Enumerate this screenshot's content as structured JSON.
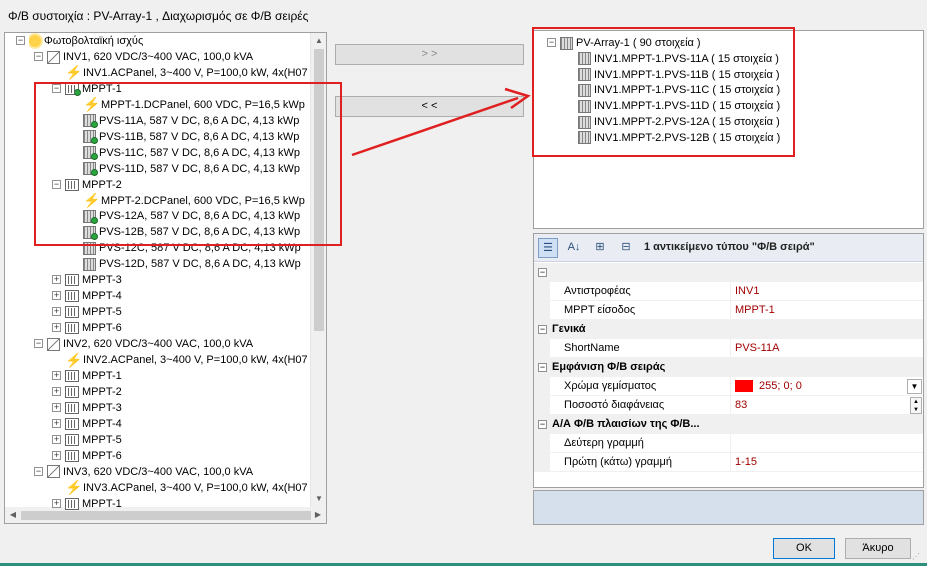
{
  "window": {
    "title": "Φ/Β συστοιχία : PV-Array-1 , Διαχωρισμός σε Φ/Β σειρές"
  },
  "buttons": {
    "add": "> >",
    "remove": "< <",
    "ok": "OK",
    "cancel": "Άκυρο"
  },
  "left_tree": [
    {
      "text": "Φωτοβολταϊκή ισχύς",
      "icon": "sun-icon",
      "exp": "−",
      "level": 0
    },
    {
      "text": "INV1, 620 VDC/3~400 VAC, 100,0 kVA",
      "icon": "inverter-icon",
      "exp": "−",
      "level": 1
    },
    {
      "text": "INV1.ACPanel, 3~400 V, P=100,0 kW, 4x(H07",
      "icon": "bolt-icon",
      "exp": "",
      "level": 2
    },
    {
      "text": "MPPT-1",
      "icon": "mppt-icon",
      "exp": "−",
      "level": 2,
      "dot": true
    },
    {
      "text": "MPPT-1.DCPanel, 600 VDC,  P=16,5 kWp",
      "icon": "bolt-icon",
      "exp": "",
      "level": 3
    },
    {
      "text": "PVS-11A, 587 V DC, 8,6 A DC, 4,13 kWp",
      "icon": "pv-string-icon",
      "exp": "",
      "level": 3,
      "dot": true
    },
    {
      "text": "PVS-11B, 587 V DC, 8,6 A DC, 4,13 kWp",
      "icon": "pv-string-icon",
      "exp": "",
      "level": 3,
      "dot": true
    },
    {
      "text": "PVS-11C, 587 V DC, 8,6 A DC, 4,13 kWp",
      "icon": "pv-string-icon",
      "exp": "",
      "level": 3,
      "dot": true
    },
    {
      "text": "PVS-11D, 587 V DC, 8,6 A DC, 4,13 kWp",
      "icon": "pv-string-icon",
      "exp": "",
      "level": 3,
      "dot": true
    },
    {
      "text": "MPPT-2",
      "icon": "mppt-icon",
      "exp": "−",
      "level": 2
    },
    {
      "text": "MPPT-2.DCPanel, 600 VDC,  P=16,5 kWp",
      "icon": "bolt-icon",
      "exp": "",
      "level": 3
    },
    {
      "text": "PVS-12A, 587 V DC, 8,6 A DC, 4,13 kWp",
      "icon": "pv-string-icon",
      "exp": "",
      "level": 3,
      "dot": true
    },
    {
      "text": "PVS-12B, 587 V DC, 8,6 A DC, 4,13 kWp",
      "icon": "pv-string-icon",
      "exp": "",
      "level": 3,
      "dot": true
    },
    {
      "text": "PVS-12C, 587 V DC, 8,6 A DC, 4,13 kWp",
      "icon": "pv-string-icon",
      "exp": "",
      "level": 3
    },
    {
      "text": "PVS-12D, 587 V DC, 8,6 A DC, 4,13 kWp",
      "icon": "pv-string-icon",
      "exp": "",
      "level": 3
    },
    {
      "text": "MPPT-3",
      "icon": "mppt-icon",
      "exp": "+",
      "level": 2
    },
    {
      "text": "MPPT-4",
      "icon": "mppt-icon",
      "exp": "+",
      "level": 2
    },
    {
      "text": "MPPT-5",
      "icon": "mppt-icon",
      "exp": "+",
      "level": 2
    },
    {
      "text": "MPPT-6",
      "icon": "mppt-icon",
      "exp": "+",
      "level": 2
    },
    {
      "text": "INV2, 620 VDC/3~400 VAC, 100,0 kVA",
      "icon": "inverter-icon",
      "exp": "−",
      "level": 1
    },
    {
      "text": "INV2.ACPanel, 3~400 V, P=100,0 kW, 4x(H07",
      "icon": "bolt-icon",
      "exp": "",
      "level": 2
    },
    {
      "text": "MPPT-1",
      "icon": "mppt-icon",
      "exp": "+",
      "level": 2
    },
    {
      "text": "MPPT-2",
      "icon": "mppt-icon",
      "exp": "+",
      "level": 2
    },
    {
      "text": "MPPT-3",
      "icon": "mppt-icon",
      "exp": "+",
      "level": 2
    },
    {
      "text": "MPPT-4",
      "icon": "mppt-icon",
      "exp": "+",
      "level": 2
    },
    {
      "text": "MPPT-5",
      "icon": "mppt-icon",
      "exp": "+",
      "level": 2
    },
    {
      "text": "MPPT-6",
      "icon": "mppt-icon",
      "exp": "+",
      "level": 2
    },
    {
      "text": "INV3, 620 VDC/3~400 VAC, 100,0 kVA",
      "icon": "inverter-icon",
      "exp": "−",
      "level": 1
    },
    {
      "text": "INV3.ACPanel, 3~400 V, P=100,0 kW, 4x(H07",
      "icon": "bolt-icon",
      "exp": "",
      "level": 2
    },
    {
      "text": "MPPT-1",
      "icon": "mppt-icon",
      "exp": "+",
      "level": 2
    }
  ],
  "right_tree": [
    {
      "text": "PV-Array-1 ( 90 στοιχεία )",
      "icon": "pv-string-icon",
      "exp": "−",
      "level": 0
    },
    {
      "text": "INV1.MPPT-1.PVS-11A ( 15 στοιχεία )",
      "icon": "pv-string-icon",
      "exp": "",
      "level": 1
    },
    {
      "text": "INV1.MPPT-1.PVS-11B ( 15 στοιχεία )",
      "icon": "pv-string-icon",
      "exp": "",
      "level": 1
    },
    {
      "text": "INV1.MPPT-1.PVS-11C ( 15 στοιχεία )",
      "icon": "pv-string-icon",
      "exp": "",
      "level": 1
    },
    {
      "text": "INV1.MPPT-1.PVS-11D ( 15 στοιχεία )",
      "icon": "pv-string-icon",
      "exp": "",
      "level": 1
    },
    {
      "text": "INV1.MPPT-2.PVS-12A ( 15 στοιχεία )",
      "icon": "pv-string-icon",
      "exp": "",
      "level": 1
    },
    {
      "text": "INV1.MPPT-2.PVS-12B ( 15 στοιχεία )",
      "icon": "pv-string-icon",
      "exp": "",
      "level": 1
    }
  ],
  "props": {
    "header": "1 αντικείμενο τύπου  \"Φ/Β σειρά\"",
    "rows": [
      {
        "type": "cat",
        "name": ""
      },
      {
        "type": "prop",
        "name": "Αντιστροφέας",
        "value": "INV1"
      },
      {
        "type": "prop",
        "name": "MPPT είσοδος",
        "value": "MPPT-1"
      },
      {
        "type": "cat",
        "name": "Γενικά"
      },
      {
        "type": "prop",
        "name": "ShortName",
        "value": "PVS-11A"
      },
      {
        "type": "cat",
        "name": "Εμφάνιση Φ/Β σειράς"
      },
      {
        "type": "prop",
        "name": "Χρώμα γεμίσματος",
        "value": "255; 0; 0",
        "swatch": "#ff0000",
        "control": "dropdown"
      },
      {
        "type": "prop",
        "name": "Ποσοστό διαφάνειας",
        "value": "83",
        "control": "spinner"
      },
      {
        "type": "cat",
        "name": "Α/Α Φ/Β πλαισίων της  Φ/Β..."
      },
      {
        "type": "prop",
        "name": "Δεύτερη γραμμή",
        "value": ""
      },
      {
        "type": "prop",
        "name": "Πρώτη (κάτω) γραμμή",
        "value": "1-15"
      }
    ]
  },
  "colors": {
    "highlight": "#e02020",
    "accent": "#0078d7",
    "value_text": "#a10000"
  }
}
